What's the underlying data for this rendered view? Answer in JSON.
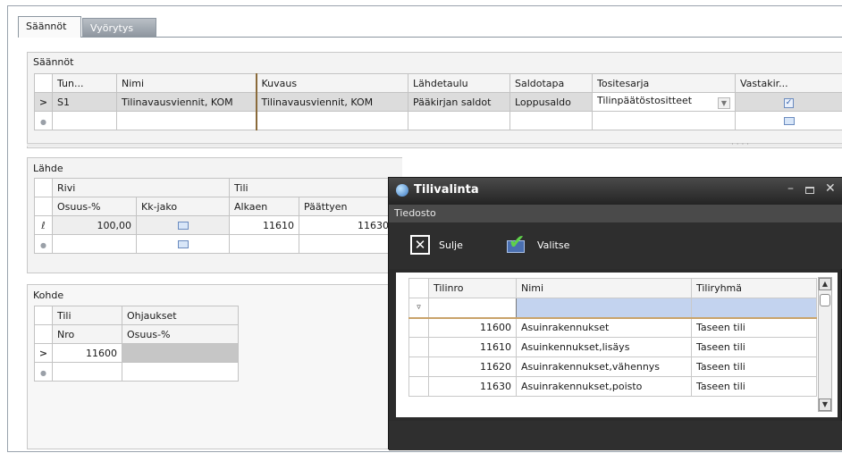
{
  "tabs": [
    {
      "label": "Säännöt",
      "active": true
    },
    {
      "label": "Vyörytys",
      "active": false
    }
  ],
  "rules": {
    "group_title": "Säännöt",
    "columns": [
      "Tun...",
      "Nimi",
      "Kuvaus",
      "Lähdetaulu",
      "Saldotapa",
      "Tositesarja",
      "Vastakir..."
    ],
    "rows": [
      {
        "tunnus": "S1",
        "nimi": "Tilinavausviennit, KOM",
        "kuvaus": "Tilinavausviennit, KOM",
        "lahdetaulu": "Pääkirjan saldot",
        "saldotapa": "Loppusaldo",
        "tositesarja": "Tilinpäätöstositteet",
        "vastakirjaus": true
      }
    ]
  },
  "source": {
    "group_title": "Lähde",
    "band_headers": [
      "Rivi",
      "Tili"
    ],
    "columns": [
      "Osuus-%",
      "Kk-jako",
      "Alkaen",
      "Päättyen"
    ],
    "rows": [
      {
        "osuus": "100,00",
        "alkaen": "11610",
        "paattyen": "11630"
      }
    ]
  },
  "target": {
    "group_title": "Kohde",
    "band_headers": [
      "Tili",
      "Ohjaukset"
    ],
    "columns": [
      "Nro",
      "Osuus-%"
    ],
    "rows": [
      {
        "nro": "11600",
        "osuus": ""
      }
    ]
  },
  "dialog": {
    "title": "Tilivalinta",
    "menu": [
      "Tiedosto"
    ],
    "buttons": {
      "close": "Sulje",
      "select": "Valitse"
    },
    "window_icons": [
      "minimize-icon",
      "maximize-icon",
      "close-icon"
    ],
    "columns": [
      "Tilinro",
      "Nimi",
      "Tiliryhmä"
    ],
    "rows": [
      {
        "tilinro": "11600",
        "nimi": "Asuinrakennukset",
        "tiliryhma": "Taseen tili"
      },
      {
        "tilinro": "11610",
        "nimi": "Asuinkennukset,lisäys",
        "tiliryhma": "Taseen tili"
      },
      {
        "tilinro": "11620",
        "nimi": "Asuinrakennukset,vähennys",
        "tiliryhma": "Taseen tili"
      },
      {
        "tilinro": "11630",
        "nimi": "Asuinrakennukset,poisto",
        "tiliryhma": "Taseen tili"
      }
    ]
  },
  "colors": {
    "dialog_bg": "#2b2b2b",
    "filter_row": "#c3d3ef",
    "selected_row": "#dcdcdc",
    "checkbox_blue": "#2a5aa8"
  }
}
